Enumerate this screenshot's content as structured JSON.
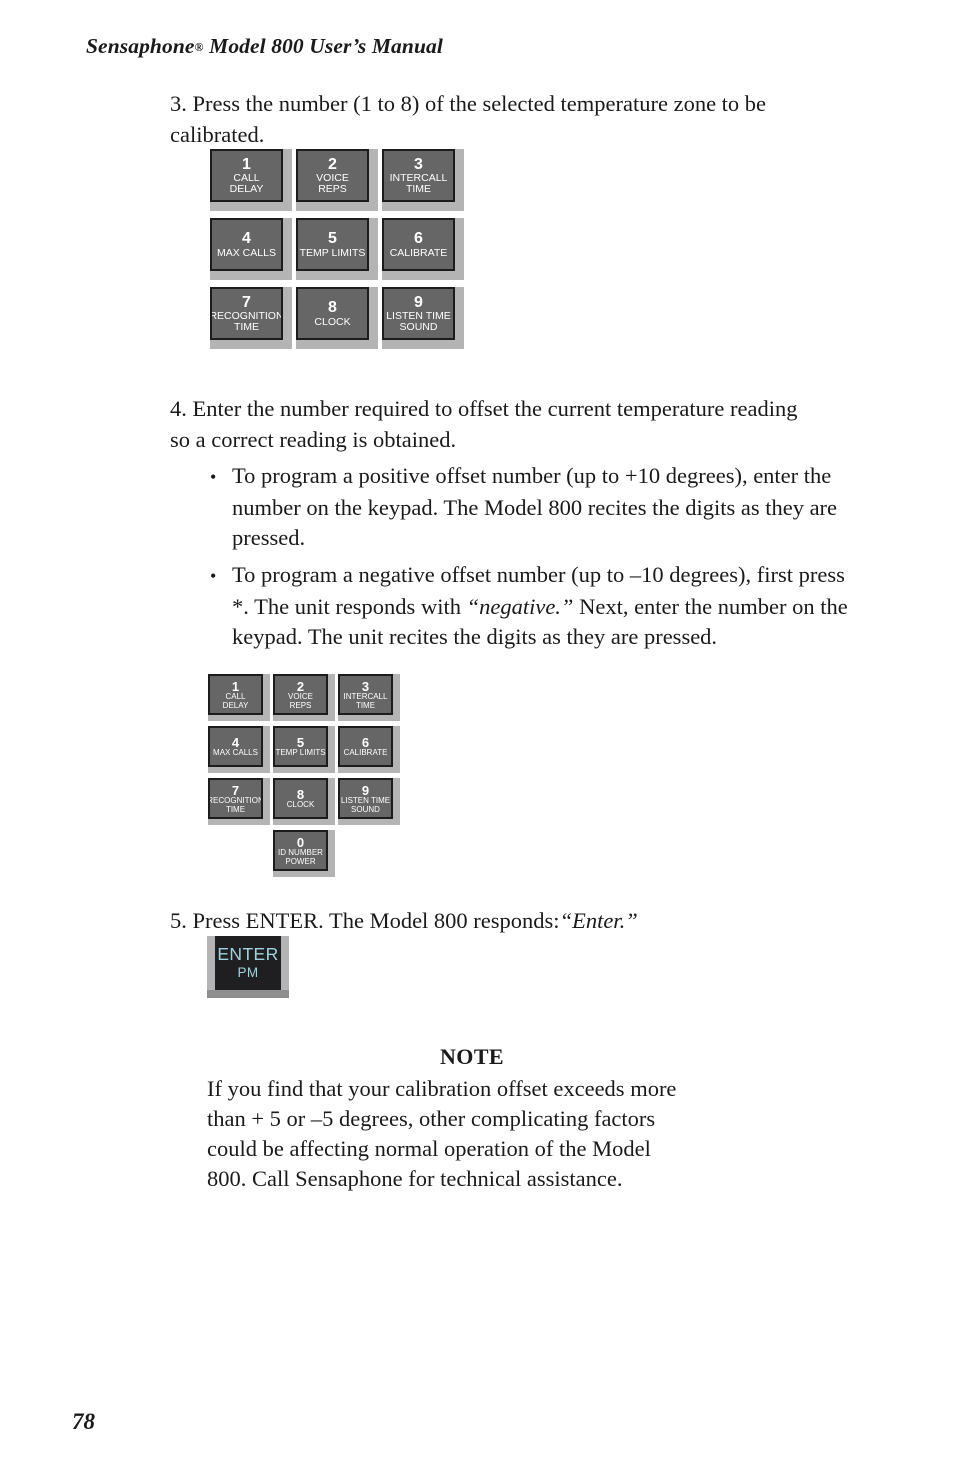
{
  "header": {
    "brand": "Sensaphone",
    "registered_mark": "®",
    "title_rest": " Model 800 User’s Manual"
  },
  "steps": {
    "step3": "3.  Press the number (1 to 8) of the selected temperature zone to be calibrated.",
    "step4": "4.  Enter the number required to offset the current temperature reading so a correct reading is obtained.",
    "step5_before": "5.  Press ENTER. The Model 800 responds:",
    "step5_quote": "“Enter.”"
  },
  "bullets": [
    {
      "glyph": "•",
      "text": "To program a positive offset number (up to +10 degrees), enter the number on the keypad. The Model 800 recites the digits as they are pressed."
    },
    {
      "glyph": "•",
      "part1": "To program a negative offset number (up to –10 degrees), first press *. The unit responds with ",
      "italic": "“negative.”",
      "part2": " Next, enter the number on the keypad. The unit recites the digits as they are pressed."
    }
  ],
  "keypad_large": {
    "rows": [
      [
        {
          "digit": "1",
          "lines": [
            "CALL",
            "DELAY"
          ]
        },
        {
          "digit": "2",
          "lines": [
            "VOICE",
            "REPS"
          ]
        },
        {
          "digit": "3",
          "lines": [
            "INTERCALL",
            "TIME"
          ]
        }
      ],
      [
        {
          "digit": "4",
          "lines": [
            "MAX CALLS"
          ]
        },
        {
          "digit": "5",
          "lines": [
            "TEMP LIMITS"
          ]
        },
        {
          "digit": "6",
          "lines": [
            "CALIBRATE"
          ]
        }
      ],
      [
        {
          "digit": "7",
          "lines": [
            "RECOGNITION",
            "TIME"
          ]
        },
        {
          "digit": "8",
          "lines": [
            "CLOCK"
          ]
        },
        {
          "digit": "9",
          "lines": [
            "LISTEN TIME",
            "SOUND"
          ]
        }
      ]
    ]
  },
  "keypad_small": {
    "rows": [
      [
        {
          "digit": "1",
          "lines": [
            "CALL",
            "DELAY"
          ]
        },
        {
          "digit": "2",
          "lines": [
            "VOICE",
            "REPS"
          ]
        },
        {
          "digit": "3",
          "lines": [
            "INTERCALL",
            "TIME"
          ]
        }
      ],
      [
        {
          "digit": "4",
          "lines": [
            "MAX CALLS"
          ]
        },
        {
          "digit": "5",
          "lines": [
            "TEMP LIMITS"
          ]
        },
        {
          "digit": "6",
          "lines": [
            "CALIBRATE"
          ]
        }
      ],
      [
        {
          "digit": "7",
          "lines": [
            "RECOGNITION",
            "TIME"
          ]
        },
        {
          "digit": "8",
          "lines": [
            "CLOCK"
          ]
        },
        {
          "digit": "9",
          "lines": [
            "LISTEN TIME",
            "SOUND"
          ]
        }
      ],
      [
        {
          "digit": "0",
          "lines": [
            "ID NUMBER",
            "POWER"
          ]
        }
      ]
    ]
  },
  "enter_key": {
    "main": "ENTER",
    "sub": "PM"
  },
  "note": {
    "title": "NOTE",
    "lines": [
      "If you find that your calibration offset exceeds more",
      "than + 5 or –5 degrees, other complicating factors",
      "could be affecting normal operation of the Model",
      "800. Call Sensaphone for technical assistance."
    ]
  },
  "folio": "78",
  "colors": {
    "key_face": "#666666",
    "key_border": "#1c1c1c",
    "key_bevel": "#b4b4b4",
    "enter_face": "#1f1f22",
    "enter_text": "#9fd4de",
    "page_bg": "#ffffff",
    "text": "#1a1a1a"
  }
}
